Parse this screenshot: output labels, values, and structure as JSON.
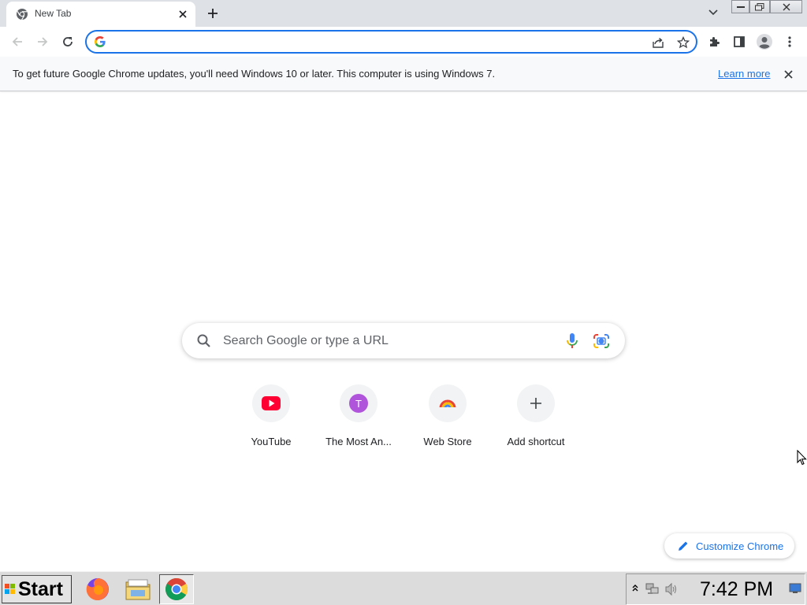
{
  "tab": {
    "title": "New Tab",
    "favicon": "chrome-icon"
  },
  "omnibox": {
    "value": "",
    "placeholder": ""
  },
  "infobar": {
    "message": "To get future Google Chrome updates, you'll need Windows 10 or later. This computer is using Windows 7.",
    "link": "Learn more"
  },
  "search": {
    "placeholder": "Search Google or type a URL"
  },
  "shortcuts": [
    {
      "title": "YouTube",
      "icon": "youtube-icon"
    },
    {
      "title": "The Most An...",
      "icon": "letter-avatar",
      "letter": "T"
    },
    {
      "title": "Web Store",
      "icon": "web-store-icon"
    },
    {
      "title": "Add shortcut",
      "icon": "plus-icon"
    }
  ],
  "customize": {
    "label": "Customize Chrome"
  },
  "taskbar": {
    "start_label": "Start",
    "apps": [
      "firefox-icon",
      "file-manager-icon",
      "chrome-icon"
    ],
    "clock": "7:42 PM"
  },
  "colors": {
    "accent": "#1a73e8",
    "tabstrip": "#dee1e6",
    "taskbar": "#dcdcdc",
    "letter_avatar": "#b154dc"
  }
}
